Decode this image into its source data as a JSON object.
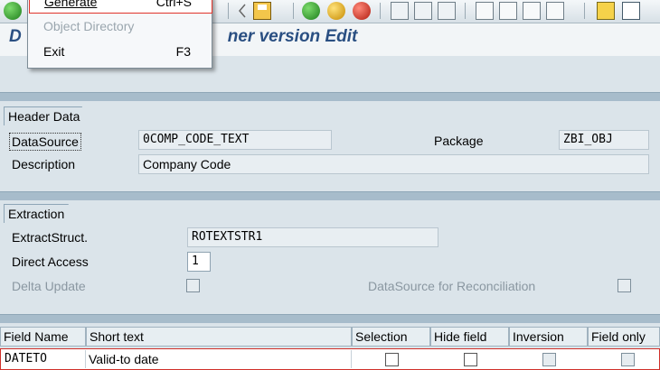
{
  "title": "D",
  "title_tail": "ner version Edit",
  "menu": {
    "items": [
      {
        "label": "Generate",
        "shortcut": "Ctrl+S",
        "state": "active"
      },
      {
        "label": "Object Directory",
        "shortcut": "",
        "state": "disabled"
      },
      {
        "label": "Exit",
        "shortcut": "F3",
        "state": "normal"
      }
    ]
  },
  "header": {
    "tab": "Header Data",
    "datasource_label": "DataSource",
    "datasource_value": "0COMP_CODE_TEXT",
    "package_label": "Package",
    "package_value": "ZBI_OBJ",
    "description_label": "Description",
    "description_value": "Company Code"
  },
  "extraction": {
    "tab": "Extraction",
    "extract_label": "ExtractStruct.",
    "extract_value": "ROTEXTSTR1",
    "direct_label": "Direct Access",
    "direct_value": "1",
    "delta_label": "Delta Update",
    "recon_label": "DataSource for Reconciliation"
  },
  "table": {
    "columns": [
      "Field Name",
      "Short text",
      "Selection",
      "Hide field",
      "Inversion",
      "Field only"
    ],
    "rows": [
      {
        "field": "DATETO",
        "text": "Valid-to date"
      }
    ]
  },
  "colors": {
    "title": "#2a4f82",
    "highlight": "#d0302a"
  }
}
